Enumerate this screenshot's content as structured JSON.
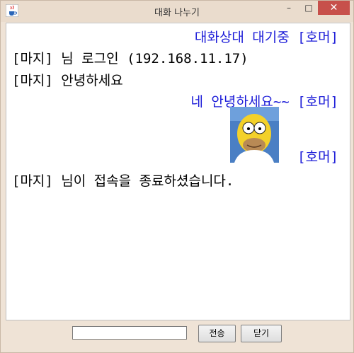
{
  "window": {
    "title": "대화 나누기"
  },
  "controls": {
    "minimize": "–",
    "maximize": "□",
    "close": "✕"
  },
  "chat": {
    "lines": [
      "대화상대 대기중 [호머]",
      "[마지] 님 로그인 (192.168.11.17)",
      "[마지] 안녕하세요",
      "네 안녕하세요~~ [호머]",
      "[호머]",
      "[마지] 님이 접속을 종료하셨습니다."
    ]
  },
  "footer": {
    "message_input_value": "",
    "send_label": "전송",
    "close_label": "닫기"
  },
  "colors": {
    "self": "#1c1cd8",
    "other": "#000000",
    "close_button": "#c7504b"
  }
}
